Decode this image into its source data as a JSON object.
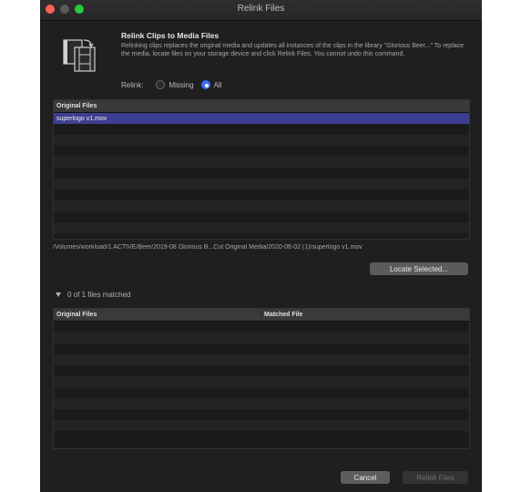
{
  "window": {
    "title": "Relink Files"
  },
  "header": {
    "heading": "Relink Clips to Media Files",
    "description": "Relinking clips replaces the original media and updates all instances of the clips in the library \"Glorious Beer...\" To replace the media, locate files on your storage device and click Relink Files. You cannot undo this command.",
    "icon": "document-stack-icon"
  },
  "relink": {
    "label": "Relink:",
    "options": [
      {
        "label": "Missing",
        "selected": false
      },
      {
        "label": "All",
        "selected": true
      }
    ]
  },
  "original_table": {
    "header": "Original Files",
    "rows": [
      "superlogo v1.mov"
    ]
  },
  "path": "/Volumes/workload/1 ACTIVE/Beer/2019-08 Glorious B...Cut Original Media/2020-06-02 (1)/superlogo v1.mov",
  "locate_button": "Locate Selected...",
  "matched": {
    "label": "0 of 1 files matched"
  },
  "matched_table": {
    "headers": [
      "Original Files",
      "Matched File"
    ]
  },
  "footer": {
    "cancel": "Cancel",
    "relink": "Relink Files"
  },
  "colors": {
    "accent": "#3d6df0",
    "selection": "#3c3f8f",
    "close": "#fe5f57",
    "maximize": "#2bc840"
  }
}
